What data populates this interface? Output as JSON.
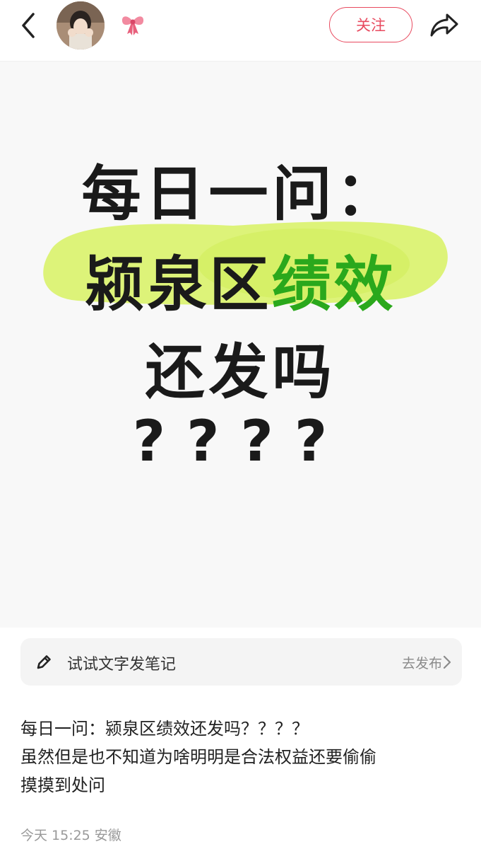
{
  "header": {
    "follow_label": "关注",
    "back_icon": "chevron-left-icon",
    "share_icon": "share-arrow-icon",
    "badge_icon": "bow-icon",
    "brand_color": "#e84a5f"
  },
  "post_image": {
    "line1": "每日一问：",
    "line2_plain": "颍泉区",
    "line2_green": "绩效",
    "line3": "还发吗",
    "line4": "????",
    "highlight_color": "#d9f26a",
    "green_color": "#2aa81c"
  },
  "try_note": {
    "label": "试试文字发笔记",
    "action": "去发布",
    "icon": "pencil-icon"
  },
  "caption": {
    "line1": "每日一问：颍泉区绩效还发吗？？？？",
    "line2": "虽然但是也不知道为啥明明是合法权益还要偷偷",
    "line3": "摸摸到处问"
  },
  "meta": {
    "date": "今天",
    "time": "15:25",
    "location": "安徽"
  }
}
